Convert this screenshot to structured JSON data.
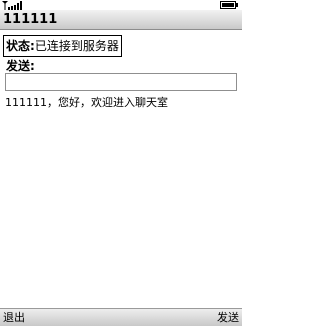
{
  "status_bar": {
    "signal_icon": "signal-strength-icon",
    "battery_icon": "battery-icon"
  },
  "title_bar": {
    "title": "111111"
  },
  "status": {
    "label": "状态:",
    "value": "已连接到服务器"
  },
  "send": {
    "label": "发送:",
    "input_value": ""
  },
  "messages": [
    "111111，您好，欢迎进入聊天室"
  ],
  "softkeys": {
    "left": "退出",
    "right": "发送"
  }
}
